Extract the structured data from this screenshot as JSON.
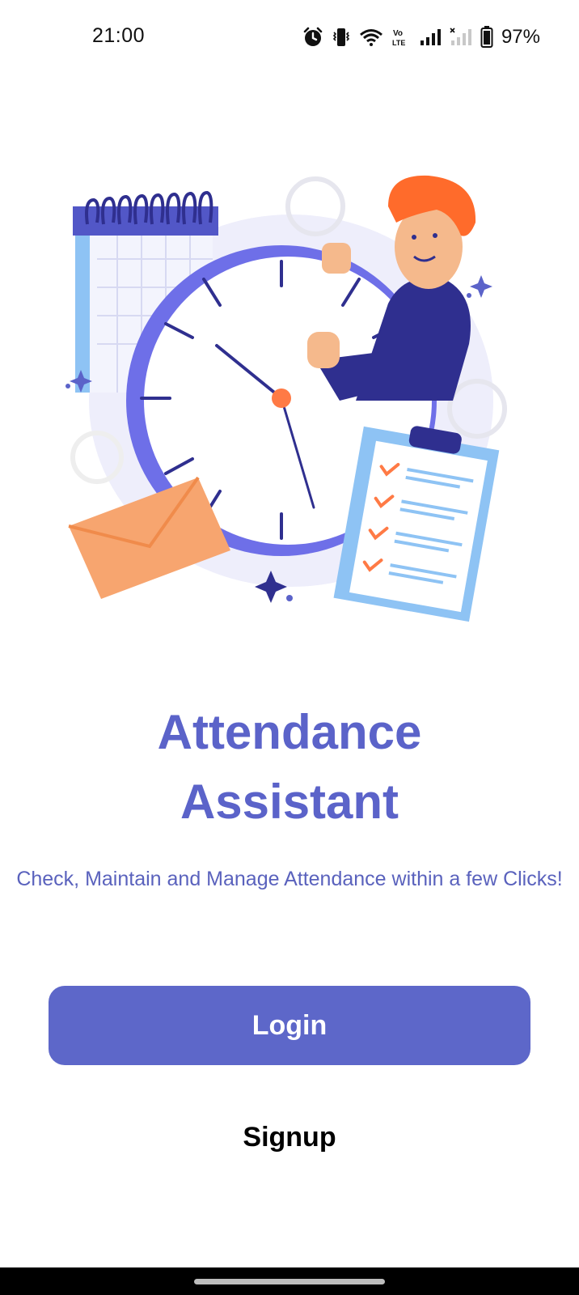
{
  "status_bar": {
    "time": "21:00",
    "battery": "97%",
    "icons": [
      "alarm-icon",
      "vibrate-icon",
      "wifi-icon",
      "volte-icon",
      "signal-icon",
      "signal-empty-icon",
      "battery-icon"
    ]
  },
  "hero": {
    "illustration": "attendance-clock-illustration"
  },
  "app": {
    "title_line1": "Attendance",
    "title_line2": "Assistant",
    "subtitle": "Check, Maintain and Manage Attendance within a few Clicks!"
  },
  "actions": {
    "login_label": "Login",
    "signup_label": "Signup"
  },
  "colors": {
    "accent": "#5d67c9",
    "title": "#5b63c9",
    "subtitle": "#5a62bd",
    "clock_ring": "#6e6fe8",
    "hair": "#ff6b2b",
    "envelope": "#f7a56f"
  }
}
